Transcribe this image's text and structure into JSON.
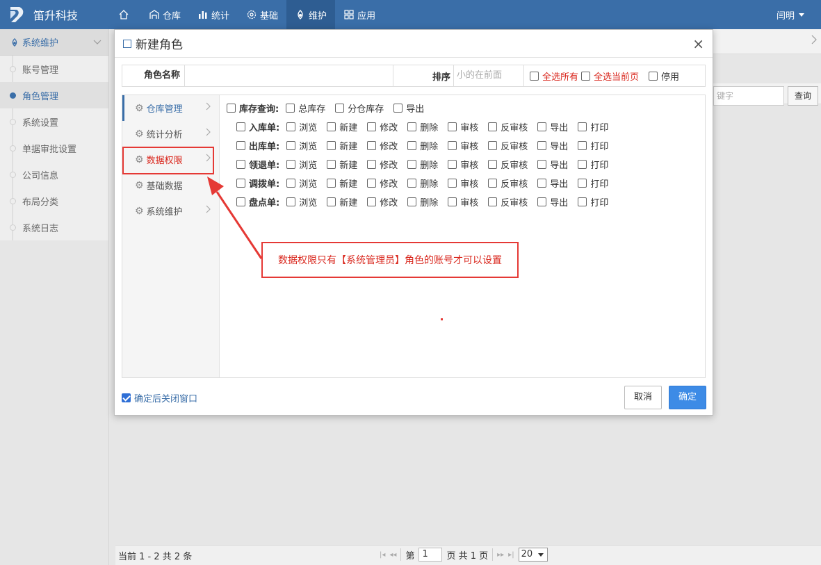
{
  "app": {
    "brand": "笛升科技",
    "user": "闫明"
  },
  "nav": [
    {
      "label": "",
      "icon": "home-icon"
    },
    {
      "label": "仓库",
      "icon": "warehouse-icon"
    },
    {
      "label": "统计",
      "icon": "bar-chart-icon"
    },
    {
      "label": "基础",
      "icon": "gear-icon"
    },
    {
      "label": "维护",
      "icon": "maintenance-icon",
      "active": true
    },
    {
      "label": "应用",
      "icon": "apps-grid-icon"
    }
  ],
  "sidebar": {
    "header": "系统维护",
    "items": [
      "账号管理",
      "角色管理",
      "系统设置",
      "单据审批设置",
      "公司信息",
      "布局分类",
      "系统日志"
    ],
    "active_index": 1
  },
  "background": {
    "search_placeholder": "键字",
    "query_button": "查询",
    "footer_count": "当前 1 - 2 共 2 条",
    "pager_prefix": "第",
    "pager_page": "1",
    "pager_suffix": "页 共 1 页",
    "page_size": "20"
  },
  "dialog": {
    "title": "新建角色",
    "close": "×",
    "name_label": "角色名称",
    "order_label": "排序",
    "order_placeholder": "小的在前面",
    "select_all": "全选所有",
    "select_page": "全选当前页",
    "disable": "停用",
    "menu": [
      "仓库管理",
      "统计分析",
      "数据权限",
      "基础数据",
      "系统维护"
    ],
    "stock_query": {
      "label": "库存查询:",
      "options": [
        "总库存",
        "分仓库存",
        "导出"
      ]
    },
    "doc_rows": [
      {
        "label": "入库单:"
      },
      {
        "label": "出库单:"
      },
      {
        "label": "领退单:"
      },
      {
        "label": "调拨单:"
      },
      {
        "label": "盘点单:"
      }
    ],
    "doc_actions": [
      "浏览",
      "新建",
      "修改",
      "删除",
      "审核",
      "反审核",
      "导出",
      "打印"
    ],
    "callout": "数据权限只有【系统管理员】角色的账号才可以设置",
    "close_after": "确定后关闭窗口",
    "cancel": "取消",
    "ok": "确定"
  },
  "colors": {
    "topbar": "#3a6ea8",
    "accent": "#3d8be6",
    "alert": "#e53935"
  }
}
